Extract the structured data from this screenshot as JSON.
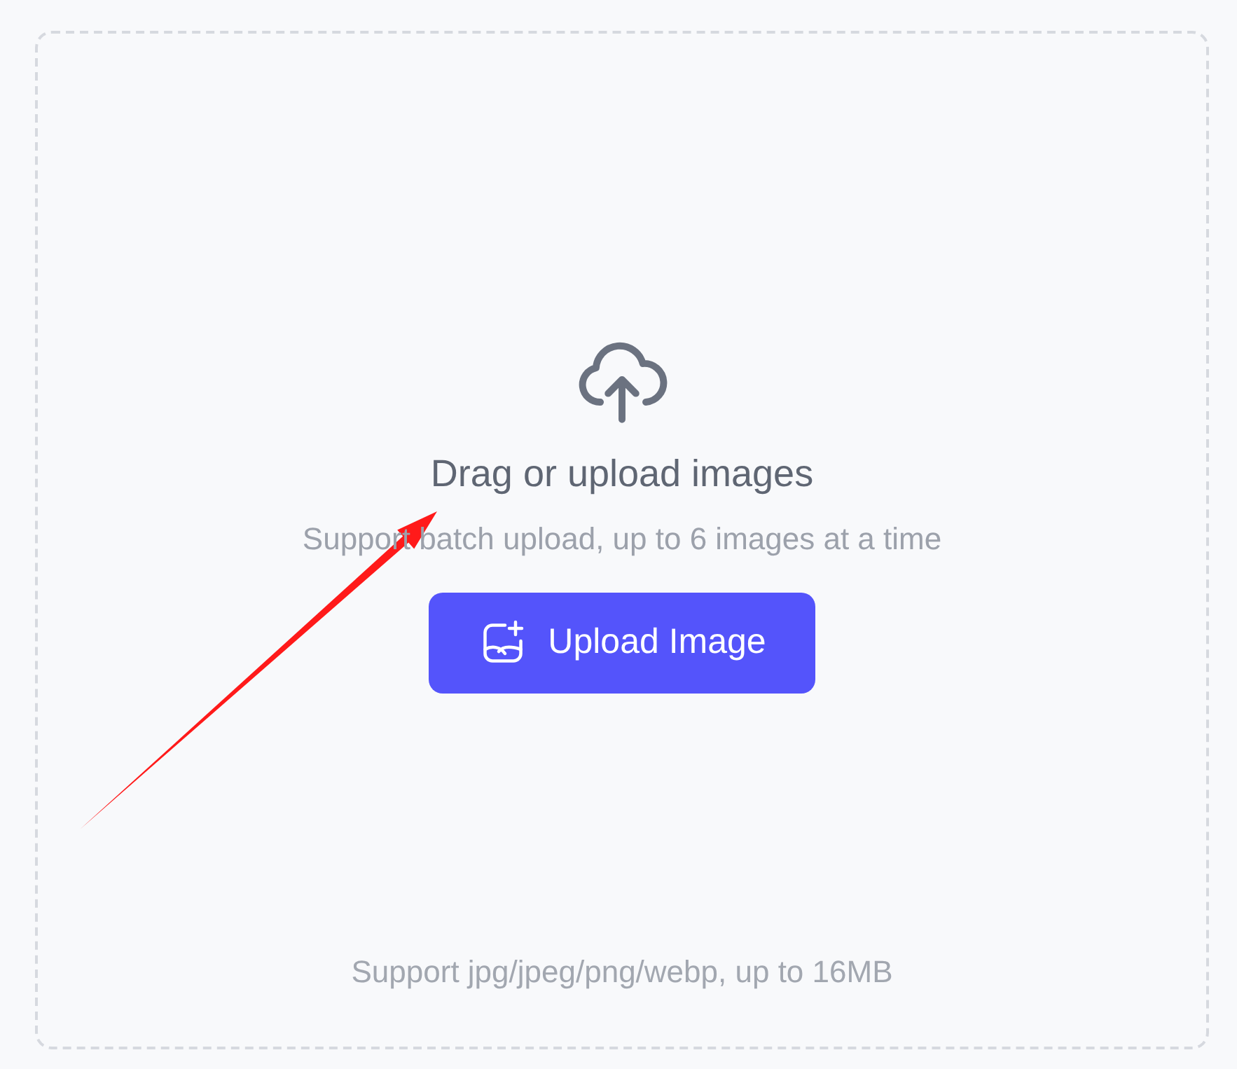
{
  "upload_area": {
    "title": "Drag or upload images",
    "subtitle": "Support batch upload, up to 6 images at a time",
    "button": "Upload Image",
    "footnote": "Support jpg/jpeg/png/webp, up to 16MB"
  }
}
